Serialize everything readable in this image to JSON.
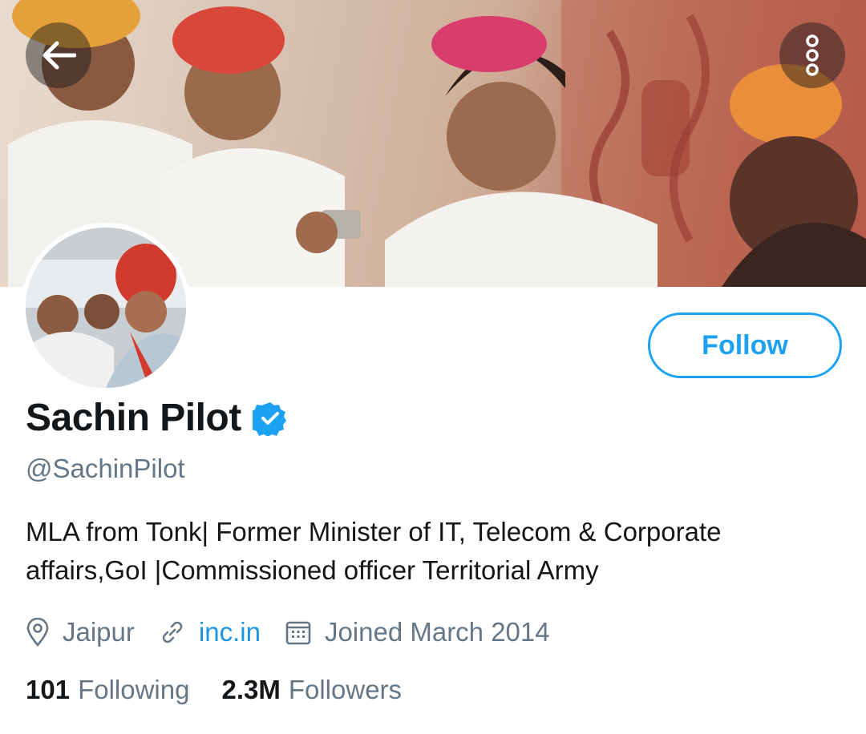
{
  "profile": {
    "name": "Sachin Pilot",
    "handle": "@SachinPilot",
    "bio": "MLA from Tonk| Former Minister of IT, Telecom & Corporate affairs,GoI |Commissioned officer Territorial Army",
    "location": "Jaipur",
    "website": "inc.in",
    "joined": "Joined March 2014",
    "verified": true
  },
  "actions": {
    "follow_label": "Follow"
  },
  "stats": {
    "following_count": "101",
    "following_label": "Following",
    "followers_count": "2.3M",
    "followers_label": "Followers"
  },
  "icons": {
    "back": "arrow-left-icon",
    "more": "more-vertical-icon",
    "verified": "verified-badge-icon",
    "location": "location-pin-icon",
    "link": "link-icon",
    "calendar": "calendar-icon"
  },
  "colors": {
    "accent": "#1da1f2",
    "link": "#1b95e0",
    "secondary_text": "#657786",
    "primary_text": "#14171a"
  }
}
